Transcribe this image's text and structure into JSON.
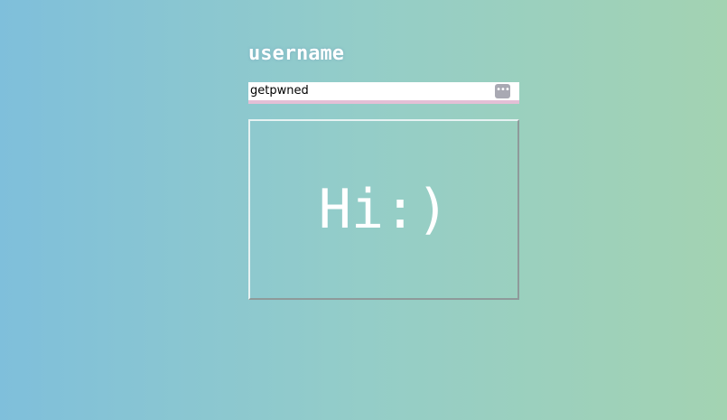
{
  "form": {
    "label": "username",
    "input": {
      "value": "getpwned",
      "placeholder": ""
    },
    "input_icon": "password-manager-key-icon"
  },
  "greeting": {
    "text": "Hi:)"
  },
  "colors": {
    "background_left": "#7fbfdb",
    "background_right": "#a3d3b2",
    "input_underline": "#e4bfd6",
    "text": "#ffffff"
  }
}
